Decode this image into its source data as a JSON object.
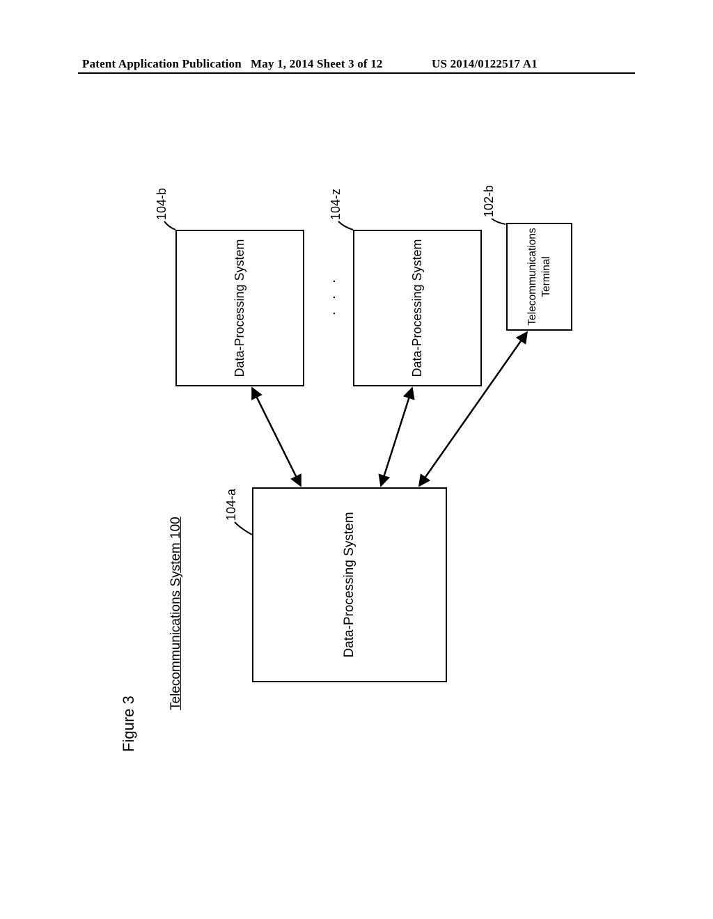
{
  "header": {
    "left": "Patent Application Publication",
    "center": "May 1, 2014  Sheet 3 of 12",
    "right": "US 2014/0122517 A1"
  },
  "figure": {
    "title": "Figure 3",
    "system_title": "Telecommunications System 100",
    "boxes": {
      "main": "Data-Processing System",
      "b": "Data-Processing System",
      "z": "Data-Processing System",
      "term_line1": "Telecommunications",
      "term_line2": "Terminal"
    },
    "ellipsis": ". . .",
    "refs": {
      "a": "104-a",
      "b": "104-b",
      "z": "104-z",
      "t": "102-b"
    }
  }
}
